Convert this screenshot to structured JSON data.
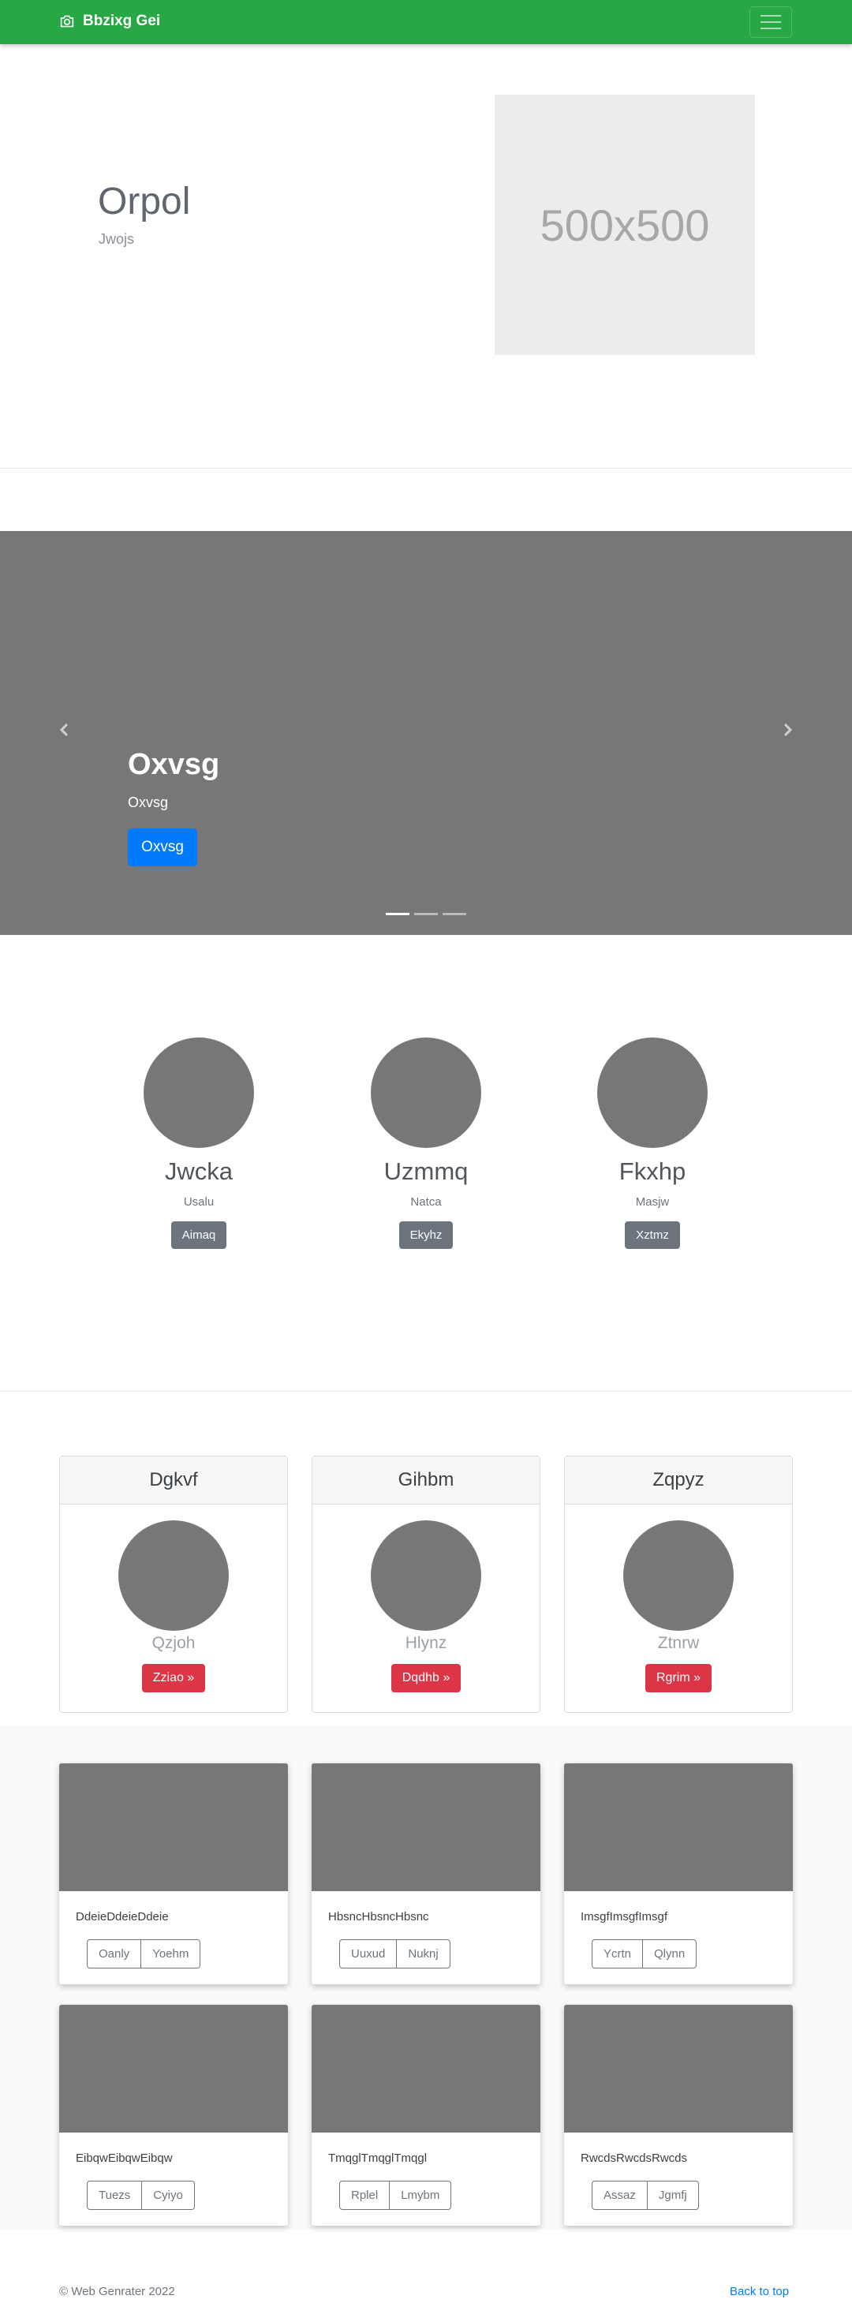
{
  "navbar": {
    "brand": "Bbzixg Gei",
    "brand_icon": "camera-icon",
    "toggler_icon": "hamburger-icon"
  },
  "hero": {
    "title": "Orpol",
    "subtitle": "Jwojs",
    "image_label": "500x500"
  },
  "carousel": {
    "title": "Oxvsg",
    "text": "Oxvsg",
    "button": "Oxvsg",
    "prev_icon": "chevron-left-icon",
    "next_icon": "chevron-right-icon",
    "slide_count": 3,
    "active_slide": 1
  },
  "marketing": [
    {
      "title": "Jwcka",
      "text": "Usalu",
      "button": "Aimaq"
    },
    {
      "title": "Uzmmq",
      "text": "Natca",
      "button": "Ekyhz"
    },
    {
      "title": "Fkxhp",
      "text": "Masjw",
      "button": "Xztmz"
    }
  ],
  "pricing": [
    {
      "header": "Dgkvf",
      "text": "Qzjoh",
      "button": "Zziao »"
    },
    {
      "header": "Gihbm",
      "text": "Hlynz",
      "button": "Dqdhb »"
    },
    {
      "header": "Zqpyz",
      "text": "Ztnrw",
      "button": "Rgrim »"
    }
  ],
  "album": [
    {
      "text": "DdeieDdeieDdeie",
      "buttons": [
        "Oanly",
        "Yoehm"
      ]
    },
    {
      "text": "HbsncHbsncHbsnc",
      "buttons": [
        "Uuxud",
        "Nuknj"
      ]
    },
    {
      "text": "ImsgfImsgfImsgf",
      "buttons": [
        "Ycrtn",
        "Qlynn"
      ]
    },
    {
      "text": "EibqwEibqwEibqw",
      "buttons": [
        "Tuezs",
        "Cyiyo"
      ]
    },
    {
      "text": "TmqglTmqglTmqgl",
      "buttons": [
        "Rplel",
        "Lmybm"
      ]
    },
    {
      "text": "RwcdsRwcdsRwcds",
      "buttons": [
        "Assaz",
        "Jgmfj"
      ]
    }
  ],
  "footer": {
    "copyright": "© Web Genrater 2022",
    "back_to_top": "Back to top"
  },
  "colors": {
    "navbar": "#28a745",
    "primary": "#007bff",
    "danger": "#dc3545",
    "secondary": "#6c757d",
    "placeholder": "#777777"
  }
}
